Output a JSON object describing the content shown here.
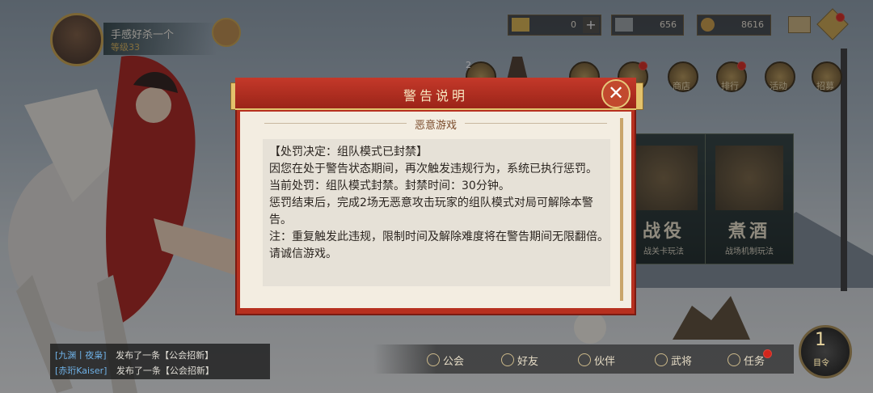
{
  "player": {
    "name": "手感好杀一个",
    "level": "等级33"
  },
  "resources": [
    {
      "icon": "gold-bar-icon",
      "value": "0"
    },
    {
      "icon": "cart-icon",
      "value": "656"
    },
    {
      "icon": "coin-icon",
      "value": "8616"
    }
  ],
  "top_menu": [
    {
      "label": "商店",
      "icon": "shop-icon"
    },
    {
      "label": "排行",
      "icon": "ranking-icon"
    },
    {
      "label": "活动",
      "icon": "event-icon"
    },
    {
      "label": "招募",
      "icon": "recruit-icon"
    }
  ],
  "top_menu_badge": "2",
  "cards": [
    {
      "title": "战役",
      "subtitle": "战关卡玩法"
    },
    {
      "title": "煮酒",
      "subtitle": "战场机制玩法"
    }
  ],
  "chat": [
    {
      "who": "[九渊丨夜枭]",
      "text": "发布了一条【公会招新】"
    },
    {
      "who": "[赤珩Kaiser]",
      "text": "发布了一条【公会招新】"
    }
  ],
  "bottom_nav": [
    {
      "label": "公会",
      "icon": "guild-icon"
    },
    {
      "label": "好友",
      "icon": "friends-icon"
    },
    {
      "label": "伙伴",
      "icon": "companion-icon"
    },
    {
      "label": "武将",
      "icon": "general-icon"
    },
    {
      "label": "任务",
      "icon": "task-icon"
    }
  ],
  "corner": {
    "number": "1",
    "label": "目令"
  },
  "dialog": {
    "title": "警告说明",
    "subtitle": "恶意游戏",
    "close_symbol": "✕",
    "lines": [
      "【处罚决定：组队模式已封禁】",
      "因您在处于警告状态期间，再次触发违规行为，系统已执行惩罚。",
      "当前处罚：组队模式封禁。封禁时间：30分钟。",
      "惩罚结束后，完成2场无恶意攻击玩家的组队模式对局可解除本警告。",
      "注：重复触发此违规，限制时间及解除难度将在警告期间无限翻倍。请诚信游戏。"
    ]
  },
  "colors": {
    "dialog_red": "#b7301f",
    "gold": "#c9a24a",
    "parchment": "#f3ede1"
  }
}
